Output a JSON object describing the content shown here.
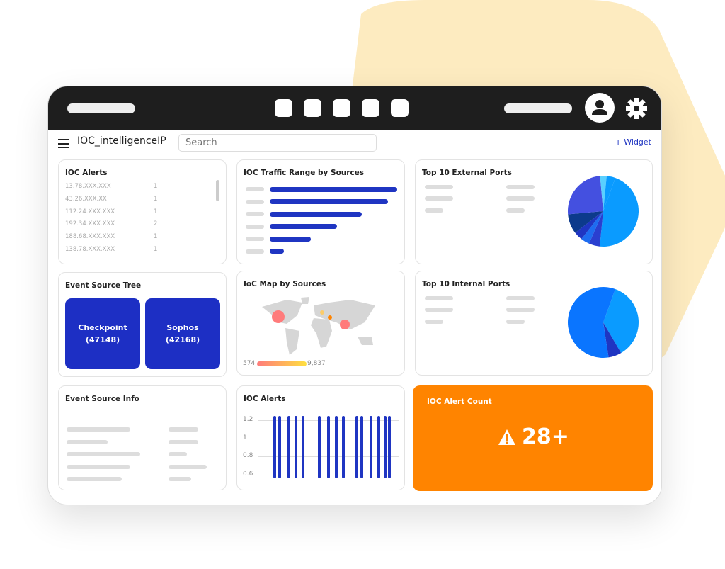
{
  "app": {
    "title": "IOC_intelligenceIP",
    "search_placeholder": "Search",
    "widget_label": "+  Widget"
  },
  "colors": {
    "accent": "#1f35c2",
    "alert": "#ff8400",
    "background_shape": "#fdebc0"
  },
  "ioc_alerts": {
    "title": "IOC Alerts",
    "rows": [
      {
        "ip": "13.78.XXX.XXX",
        "count": "1"
      },
      {
        "ip": "43.26.XXX.XX",
        "count": "1"
      },
      {
        "ip": "112.24.XXX.XXX",
        "count": "1"
      },
      {
        "ip": "192.34.XXX.XXX",
        "count": "2"
      },
      {
        "ip": "188.68.XXX.XXX",
        "count": "1"
      },
      {
        "ip": "138.78.XXX.XXX",
        "count": "1"
      }
    ]
  },
  "traffic": {
    "title": "IOC Traffic Range by Sources",
    "values": [
      100,
      93,
      72,
      53,
      32,
      11
    ]
  },
  "ext_ports": {
    "title": "Top 10 External Ports",
    "slices": [
      {
        "v": 46,
        "c": "#0a9bff"
      },
      {
        "v": 5,
        "c": "#2a3fd0"
      },
      {
        "v": 4,
        "c": "#1e6cf0"
      },
      {
        "v": 4,
        "c": "#1f35c2"
      },
      {
        "v": 9,
        "c": "#0c3a8c"
      },
      {
        "v": 25,
        "c": "#4450e0"
      },
      {
        "v": 3,
        "c": "#5ad0ff"
      },
      {
        "v": 4,
        "c": "#0a9bff"
      }
    ]
  },
  "int_ports": {
    "title": "Top 10 Internal Ports",
    "slices": [
      {
        "v": 36,
        "c": "#0a9bff"
      },
      {
        "v": 6,
        "c": "#1f35c2"
      },
      {
        "v": 58,
        "c": "#0a75ff"
      }
    ]
  },
  "tree": {
    "title": "Event Source Tree",
    "nodes": [
      {
        "name": "Checkpoint",
        "count": "(47148)"
      },
      {
        "name": "Sophos",
        "count": "(42168)"
      }
    ]
  },
  "map": {
    "title": "IoC Map by Sources",
    "min": "574",
    "max": "9,837"
  },
  "alerts_chart": {
    "title": "IOC Alerts",
    "ticks": [
      "1.2",
      "1",
      "0.8",
      "0.6"
    ]
  },
  "info": {
    "title": "Event Source Info"
  },
  "count": {
    "title": "IOC Alert Count",
    "value": "28+"
  }
}
